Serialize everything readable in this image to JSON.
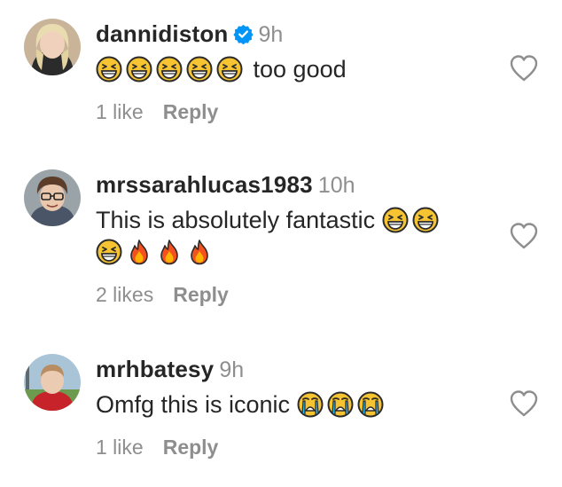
{
  "comments": [
    {
      "username": "dannidiston",
      "verified": true,
      "time": "9h",
      "text_after_emojis": "too good",
      "leading_emojis": [
        "grinning-squinting-face-emoji",
        "grinning-squinting-face-emoji",
        "grinning-squinting-face-emoji",
        "grinning-squinting-face-emoji",
        "grinning-squinting-face-emoji"
      ],
      "likes": "1 like",
      "reply_label": "Reply"
    },
    {
      "username": "mrssarahlucas1983",
      "verified": false,
      "time": "10h",
      "text": "This is absolutely fantastic",
      "trailing_emojis": [
        "grinning-squinting-face-emoji",
        "grinning-squinting-face-emoji",
        "grinning-squinting-face-emoji",
        "fire-emoji",
        "fire-emoji",
        "fire-emoji"
      ],
      "likes": "2 likes",
      "reply_label": "Reply"
    },
    {
      "username": "mrhbatesy",
      "verified": false,
      "time": "9h",
      "text": "Omfg this is iconic",
      "trailing_emojis": [
        "loudly-crying-face-emoji",
        "loudly-crying-face-emoji",
        "loudly-crying-face-emoji"
      ],
      "likes": "1 like",
      "reply_label": "Reply"
    }
  ],
  "colors": {
    "text": "#262626",
    "secondary": "#8e8e8e",
    "verified": "#0095f6"
  }
}
